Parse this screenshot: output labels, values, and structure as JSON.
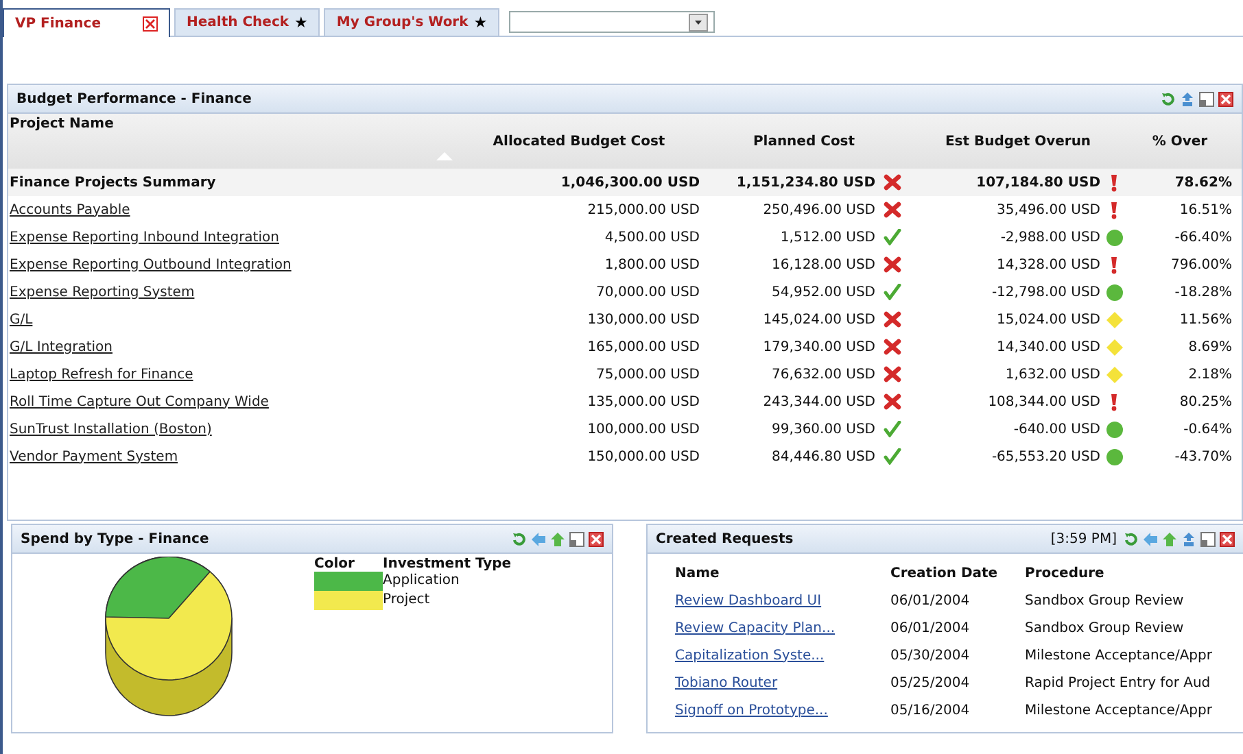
{
  "tabs": [
    {
      "label": "VP Finance",
      "selected": true,
      "closable": true
    },
    {
      "label": "Health Check",
      "selected": false,
      "mark": "★"
    },
    {
      "label": "My Group's Work",
      "selected": false,
      "mark": "★"
    }
  ],
  "budget": {
    "title": "Budget Performance - Finance",
    "columns": [
      "Project Name",
      "Allocated Budget Cost",
      "Planned Cost",
      "Est Budget Overun",
      "% Over"
    ],
    "rows": [
      {
        "kind": "summary",
        "name": "Finance Projects Summary",
        "allocated": "1,046,300.00 USD",
        "planned": "1,151,234.80 USD",
        "over_plan": true,
        "overrun": "107,184.80 USD",
        "color": "#d42a2a",
        "pct": "78.62%"
      },
      {
        "kind": "project",
        "name": "Accounts Payable",
        "allocated": "215,000.00 USD",
        "planned": "250,496.00 USD",
        "over_plan": true,
        "overrun": "35,496.00 USD",
        "color": "#d42a2a",
        "pct": "16.51%"
      },
      {
        "kind": "project",
        "name": "Expense Reporting Inbound Integration",
        "allocated": "4,500.00 USD",
        "planned": "1,512.00 USD",
        "over_plan": false,
        "overrun": "-2,988.00 USD",
        "color": "#5bb83d",
        "pct": "-66.40%"
      },
      {
        "kind": "project",
        "name": "Expense Reporting Outbound Integration",
        "allocated": "1,800.00 USD",
        "planned": "16,128.00 USD",
        "over_plan": true,
        "overrun": "14,328.00 USD",
        "color": "#d42a2a",
        "pct": "796.00%"
      },
      {
        "kind": "project",
        "name": "Expense Reporting System",
        "allocated": "70,000.00 USD",
        "planned": "54,952.00 USD",
        "over_plan": false,
        "overrun": "-12,798.00 USD",
        "color": "#5bb83d",
        "pct": "-18.28%"
      },
      {
        "kind": "project",
        "name": "G/L",
        "allocated": "130,000.00 USD",
        "planned": "145,024.00 USD",
        "over_plan": true,
        "overrun": "15,024.00 USD",
        "color": "#f4e23a",
        "pct": "11.56%"
      },
      {
        "kind": "project",
        "name": "G/L Integration",
        "allocated": "165,000.00 USD",
        "planned": "179,340.00 USD",
        "over_plan": true,
        "overrun": "14,340.00 USD",
        "color": "#f4e23a",
        "pct": "8.69%"
      },
      {
        "kind": "project",
        "name": "Laptop Refresh for Finance",
        "allocated": "75,000.00 USD",
        "planned": "76,632.00 USD",
        "over_plan": true,
        "overrun": "1,632.00 USD",
        "color": "#f4e23a",
        "pct": "2.18%"
      },
      {
        "kind": "project",
        "name": "Roll Time Capture Out Company Wide",
        "allocated": "135,000.00 USD",
        "planned": "243,344.00 USD",
        "over_plan": true,
        "overrun": "108,344.00 USD",
        "color": "#d42a2a",
        "pct": "80.25%"
      },
      {
        "kind": "project",
        "name": "SunTrust Installation (Boston)",
        "allocated": "100,000.00 USD",
        "planned": "99,360.00 USD",
        "over_plan": false,
        "overrun": "-640.00 USD",
        "color": "#5bb83d",
        "pct": "-0.64%"
      },
      {
        "kind": "project",
        "name": "Vendor Payment System",
        "allocated": "150,000.00 USD",
        "planned": "84,446.80 USD",
        "over_plan": false,
        "overrun": "-65,553.20 USD",
        "color": "#5bb83d",
        "pct": "-43.70%"
      }
    ]
  },
  "spend": {
    "title": "Spend by Type - Finance",
    "legend_headers": [
      "Color",
      "Investment Type"
    ],
    "legend": [
      {
        "label": "Application",
        "color": "#4cb848"
      },
      {
        "label": "Project",
        "color": "#f2e94e"
      }
    ]
  },
  "requests": {
    "title": "Created Requests",
    "time": "[3:59 PM]",
    "columns": [
      "Name",
      "Creation Date",
      "Procedure"
    ],
    "rows": [
      {
        "name": "Review Dashboard UI",
        "date": "06/01/2004",
        "procedure": "Sandbox Group Review"
      },
      {
        "name": "Review Capacity Plan...",
        "date": "06/01/2004",
        "procedure": "Sandbox Group Review"
      },
      {
        "name": "Capitalization Syste...",
        "date": "05/30/2004",
        "procedure": "Milestone Acceptance/Appr"
      },
      {
        "name": "Tobiano Router",
        "date": "05/25/2004",
        "procedure": "Rapid Project Entry for Aud"
      },
      {
        "name": "Signoff on Prototype...",
        "date": "05/16/2004",
        "procedure": "Milestone Acceptance/Appr"
      }
    ]
  }
}
